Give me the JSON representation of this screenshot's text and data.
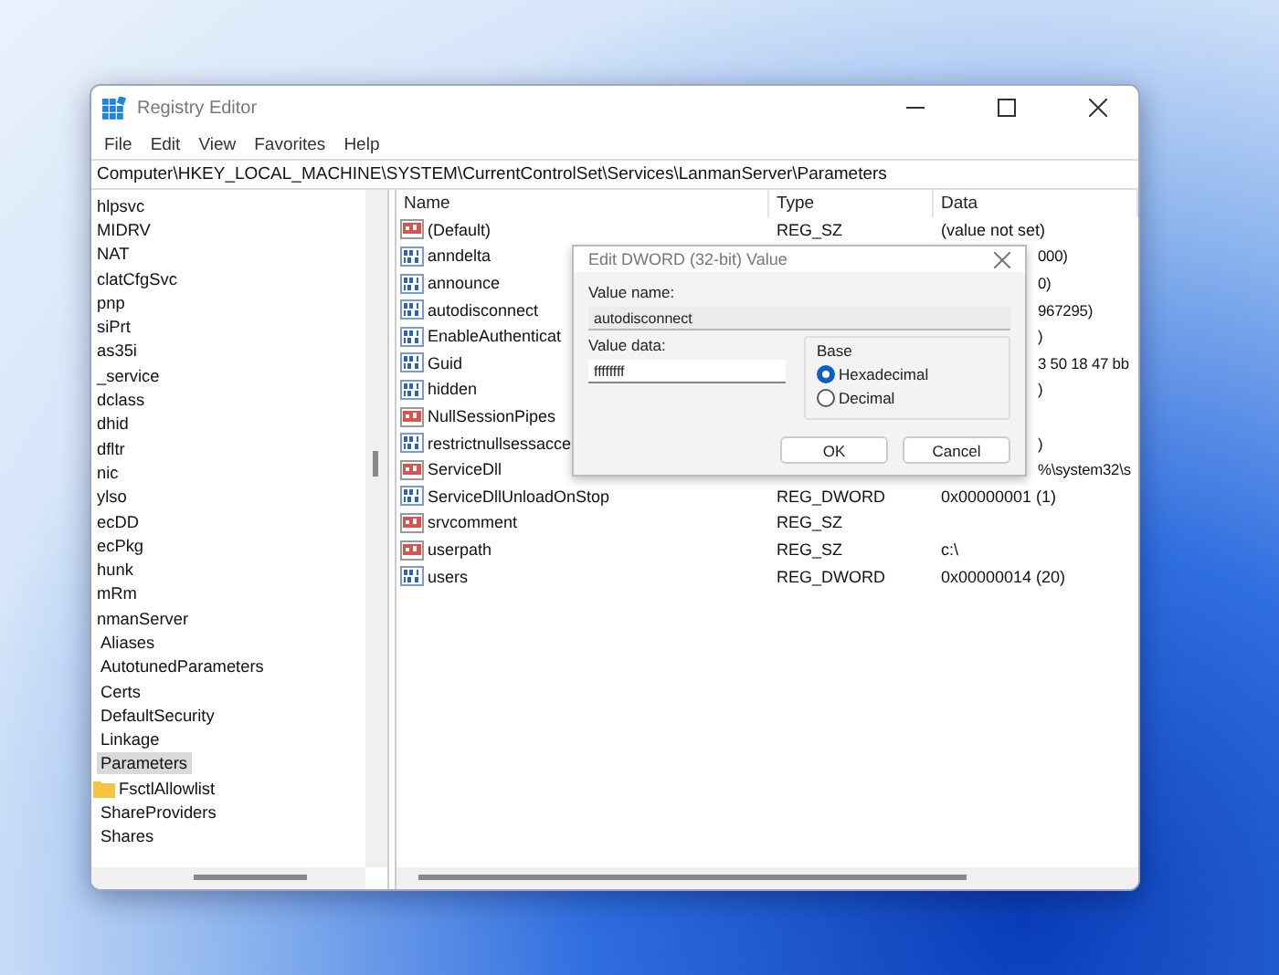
{
  "window": {
    "title": "Registry Editor"
  },
  "menu": [
    "File",
    "Edit",
    "View",
    "Favorites",
    "Help"
  ],
  "address": "Computer\\HKEY_LOCAL_MACHINE\\SYSTEM\\CurrentControlSet\\Services\\LanmanServer\\Parameters",
  "tree": [
    {
      "label": "hlpsvc",
      "selected": false
    },
    {
      "label": "MIDRV",
      "selected": false
    },
    {
      "label": "NAT",
      "selected": false
    },
    {
      "label": "clatCfgSvc",
      "selected": false
    },
    {
      "label": "pnp",
      "selected": false
    },
    {
      "label": "siPrt",
      "selected": false
    },
    {
      "label": "as35i",
      "selected": false
    },
    {
      "label": "_service",
      "selected": false
    },
    {
      "label": "dclass",
      "selected": false
    },
    {
      "label": "dhid",
      "selected": false
    },
    {
      "label": "dfltr",
      "selected": false
    },
    {
      "label": "nic",
      "selected": false
    },
    {
      "label": "ylso",
      "selected": false
    },
    {
      "label": "ecDD",
      "selected": false
    },
    {
      "label": "ecPkg",
      "selected": false
    },
    {
      "label": "hunk",
      "selected": false
    },
    {
      "label": "mRm",
      "selected": false
    },
    {
      "label": "nmanServer",
      "selected": false,
      "children": [
        {
          "label": "Aliases",
          "selected": false
        },
        {
          "label": "AutotunedParameters",
          "selected": false
        },
        {
          "label": "Certs",
          "selected": false
        },
        {
          "label": "DefaultSecurity",
          "selected": false
        },
        {
          "label": "Linkage",
          "selected": false
        },
        {
          "label": "Parameters",
          "selected": true,
          "children": [
            {
              "label": "FsctlAllowlist",
              "selected": false
            }
          ]
        },
        {
          "label": "ShareProviders",
          "selected": false
        },
        {
          "label": "Shares",
          "selected": false
        }
      ]
    }
  ],
  "table": {
    "columns": [
      "Name",
      "Type",
      "Data"
    ],
    "rows": [
      {
        "kind": "string",
        "name": "(Default)",
        "type": "REG_SZ",
        "data": "(value not set)"
      },
      {
        "kind": "dword",
        "name": "anndelta",
        "data": "000)"
      },
      {
        "kind": "dword",
        "name": "announce",
        "data": "0)"
      },
      {
        "kind": "dword",
        "name": "autodisconnect",
        "data": "967295)"
      },
      {
        "kind": "dword",
        "name": "EnableAuthenticat",
        "data": ")"
      },
      {
        "kind": "dword",
        "name": "Guid",
        "data": "3 50 18 47 bb"
      },
      {
        "kind": "dword",
        "name": "hidden",
        "data": ")"
      },
      {
        "kind": "string",
        "name": "NullSessionPipes"
      },
      {
        "kind": "dword",
        "name": "restrictnullsessacce",
        "data": ")"
      },
      {
        "kind": "string",
        "name": "ServiceDll",
        "data": "%\\system32\\s"
      },
      {
        "kind": "dword",
        "name": "ServiceDllUnloadOnStop",
        "type": "REG_DWORD",
        "data": "0x00000001 (1)"
      },
      {
        "kind": "string",
        "name": "srvcomment",
        "type": "REG_SZ"
      },
      {
        "kind": "string",
        "name": "userpath",
        "type": "REG_SZ",
        "data": "c:\\"
      },
      {
        "kind": "dword",
        "name": "users",
        "type": "REG_DWORD",
        "data": "0x00000014 (20)"
      }
    ]
  },
  "dialog": {
    "title": "Edit DWORD (32-bit) Value",
    "name_label": "Value name:",
    "name_value": "autodisconnect",
    "data_label": "Value data:",
    "data_value": "ffffffff",
    "base_label": "Base",
    "bases": [
      {
        "label": "Hexadecimal",
        "selected": true
      },
      {
        "label": "Decimal",
        "selected": false
      }
    ],
    "buttons": [
      "OK",
      "Cancel"
    ]
  }
}
